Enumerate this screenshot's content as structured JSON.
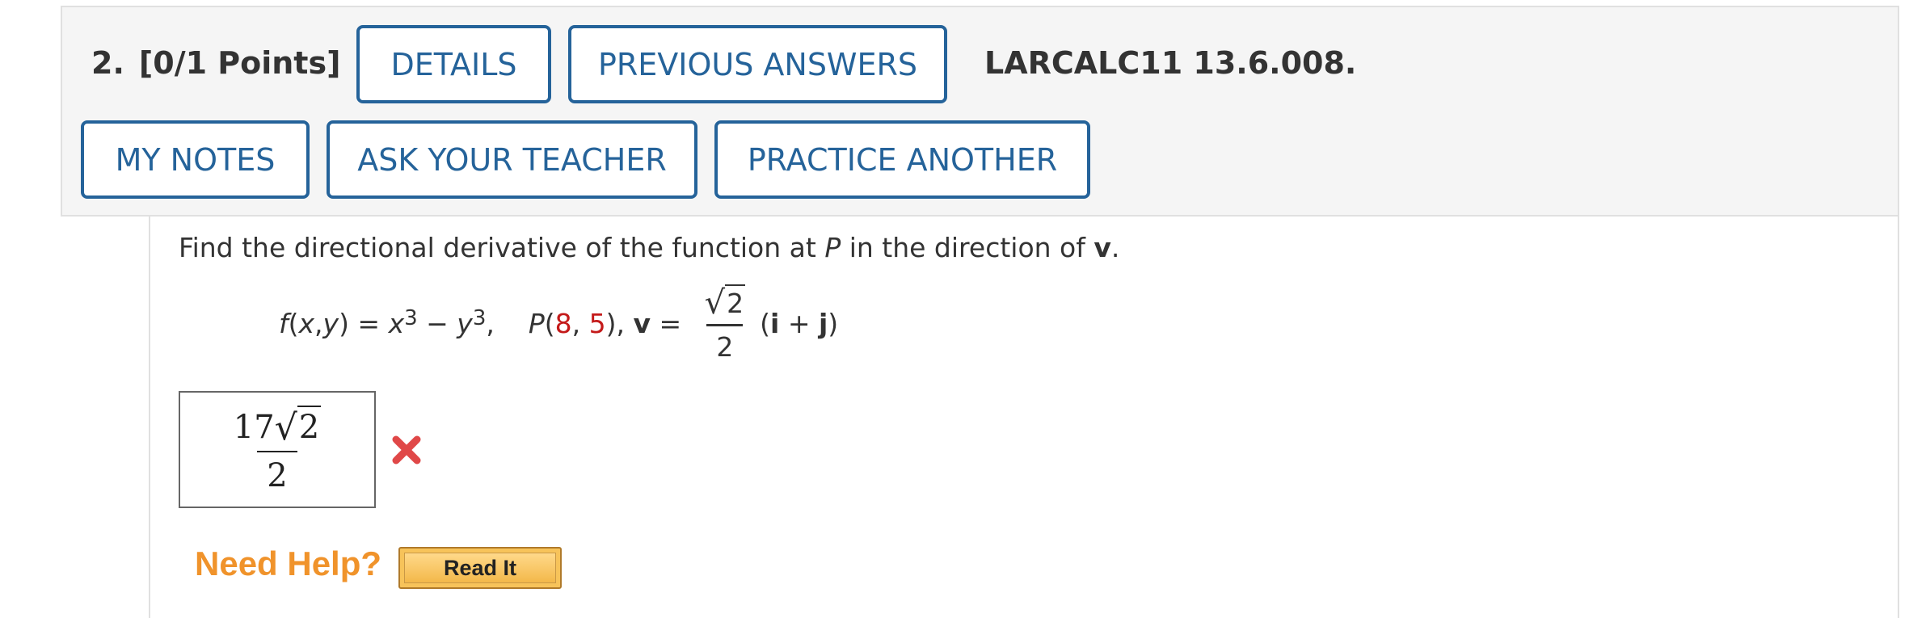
{
  "question": {
    "number": "2.",
    "points": "[0/1 Points]",
    "reference": "LARCALC11 13.6.008."
  },
  "buttons": {
    "details": "DETAILS",
    "previous_answers": "PREVIOUS ANSWERS",
    "my_notes": "MY NOTES",
    "ask_teacher": "ASK YOUR TEACHER",
    "practice_another": "PRACTICE ANOTHER"
  },
  "prompt": {
    "before_p": "Find the directional derivative of the function at ",
    "p": "P",
    "middle": " in the direction of ",
    "v": "v",
    "end": "."
  },
  "formula": {
    "f": "f",
    "open": "(",
    "x": "x",
    "comma": ", ",
    "y": "y",
    "close": ")",
    "eq": " = ",
    "x2": "x",
    "exp1": "3",
    "minus": " − ",
    "y2": "y",
    "exp2": "3",
    "sep": ",",
    "point_label": "P",
    "point_open": "(",
    "px": "8",
    "point_comma": ", ",
    "py": "5",
    "point_close": ")",
    "after_point": ", ",
    "v_label": "v",
    "v_eq": " = ",
    "radical": "√",
    "radicand": "2",
    "denominator": "2",
    "dir_open": "(",
    "i": "i",
    "plus": " + ",
    "j": "j",
    "dir_close": ")"
  },
  "answer": {
    "coefficient": "17",
    "radical": "√",
    "radicand": "2",
    "denominator": "2",
    "status": "incorrect",
    "status_color": "#e04848"
  },
  "help": {
    "label": "Need Help?",
    "read_it": "Read It"
  },
  "colors": {
    "button_border": "#25639a",
    "header_bg": "#f5f5f5",
    "accent_red": "#c41a1a",
    "help_orange": "#f0932b",
    "read_it_bg": "#f7c35a"
  }
}
